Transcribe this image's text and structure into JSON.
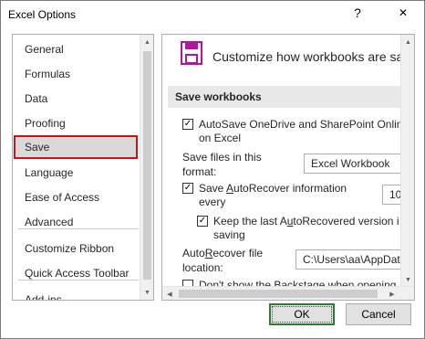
{
  "window": {
    "title": "Excel Options",
    "help_glyph": "?",
    "close_glyph": "✕"
  },
  "nav": {
    "items": [
      {
        "label": "General"
      },
      {
        "label": "Formulas"
      },
      {
        "label": "Data"
      },
      {
        "label": "Proofing"
      },
      {
        "label": "Save",
        "selected": true
      },
      {
        "label": "Language"
      },
      {
        "label": "Ease of Access"
      },
      {
        "label": "Advanced"
      },
      {
        "label": "Customize Ribbon"
      },
      {
        "label": "Quick Access Toolbar"
      },
      {
        "label": "Add-ins"
      }
    ]
  },
  "content": {
    "header": "Customize how workbooks are save",
    "section_title": "Save workbooks",
    "autosave": {
      "checked": true,
      "line1": "AutoSave OneDrive and SharePoint Onlin",
      "line2": "on Excel"
    },
    "save_format": {
      "label_line1": "Save files in this",
      "label_line2": "format:",
      "value": "Excel Workbook"
    },
    "autorecover": {
      "checked": true,
      "line1_pre": "Save ",
      "line1_u": "A",
      "line1_post": "utoRecover information",
      "line2": "every",
      "minutes_value": "10"
    },
    "keep_last": {
      "checked": true,
      "line1_pre": "Keep the last A",
      "line1_u": "u",
      "line1_post": "toRecovered version i",
      "line2": "saving"
    },
    "autorecover_location": {
      "label_line1_pre": "Auto",
      "label_line1_u": "R",
      "label_line1_post": "ecover file",
      "label_line2": "location:",
      "value": "C:\\Users\\aa\\AppData"
    },
    "dont_show": {
      "checked": false,
      "label": "Don't show the Backstage when opening"
    }
  },
  "buttons": {
    "ok": "OK",
    "cancel": "Cancel"
  },
  "colors": {
    "selected_outline": "#d01010",
    "ok_border": "#2f7d32",
    "save_icon": "#b4159e"
  }
}
